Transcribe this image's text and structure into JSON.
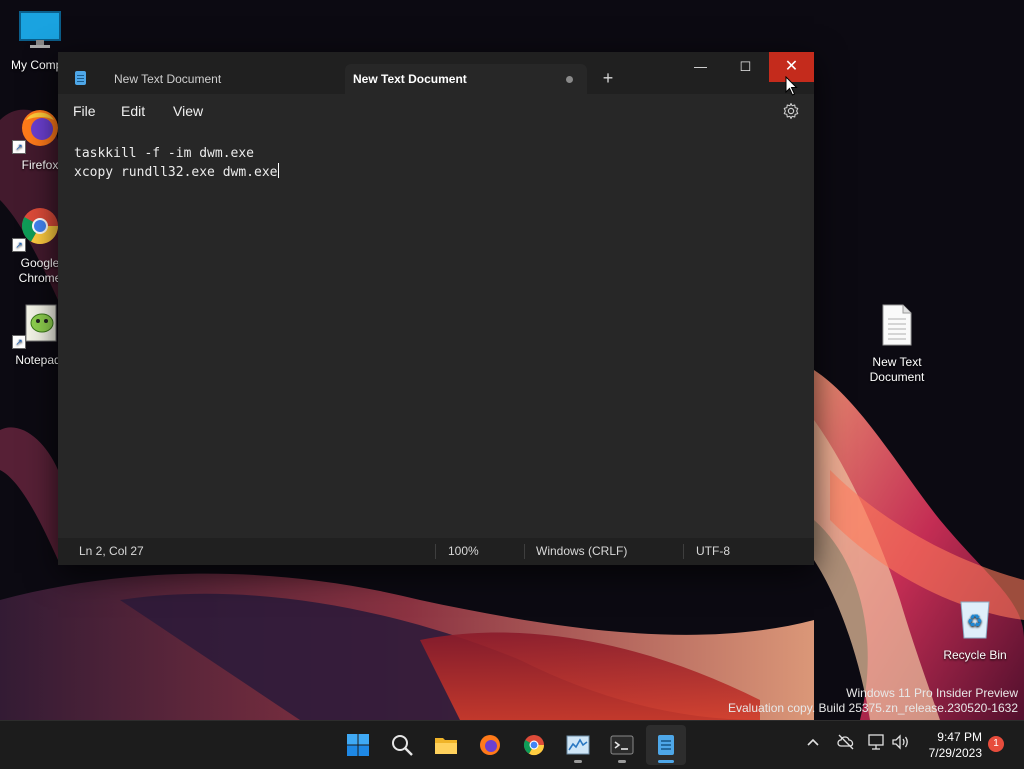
{
  "desktop": {
    "icons": [
      {
        "label": "My Compu"
      },
      {
        "label": "Firefox"
      },
      {
        "label": "Google\nChrome"
      },
      {
        "label": "Notepad-"
      },
      {
        "label": "New Text\nDocument"
      },
      {
        "label": "Recycle Bin"
      }
    ]
  },
  "window": {
    "tabs": [
      {
        "label": "New Text Document",
        "active": false
      },
      {
        "label": "New Text Document",
        "active": true,
        "unsaved": true
      }
    ],
    "new_tab_glyph": "+",
    "controls": {
      "minimize": "—",
      "maximize": "☐",
      "close": "✕"
    },
    "menu": {
      "file": "File",
      "edit": "Edit",
      "view": "View"
    },
    "editor": {
      "lines": [
        "taskkill -f -im dwm.exe",
        "xcopy rundll32.exe dwm.exe"
      ]
    },
    "status": {
      "position": "Ln 2, Col 27",
      "zoom": "100%",
      "line_ending": "Windows (CRLF)",
      "encoding": "UTF-8"
    }
  },
  "watermark": {
    "line1": "Windows 11 Pro Insider Preview",
    "line2": "Evaluation copy. Build 25375.zn_release.230520-1632"
  },
  "taskbar": {
    "apps": [
      "start-icon",
      "search-icon",
      "file-explorer-icon",
      "firefox-icon",
      "chrome-icon",
      "task-manager-icon",
      "terminal-icon",
      "notepad-icon"
    ],
    "clock": {
      "time": "9:47 PM",
      "date": "7/29/2023"
    },
    "notifications": "1"
  },
  "colors": {
    "close_hover": "#c42b1c",
    "accent": "#4ea7e8"
  }
}
